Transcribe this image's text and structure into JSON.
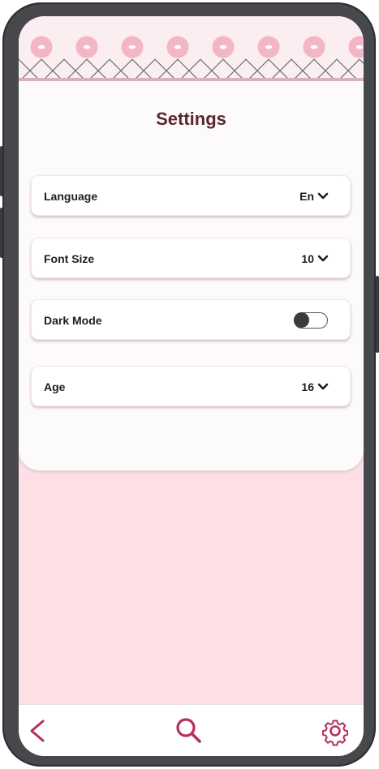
{
  "header": {
    "title": "Settings"
  },
  "settings": {
    "language": {
      "label": "Language",
      "value": "En"
    },
    "font_size": {
      "label": "Font Size",
      "value": "10"
    },
    "dark_mode": {
      "label": "Dark Mode",
      "enabled": false
    },
    "age": {
      "label": "Age",
      "value": "16"
    }
  },
  "nav": {
    "icons": [
      "back-icon",
      "search-icon",
      "gear-icon"
    ],
    "accent_color": "#b5305e"
  },
  "colors": {
    "background": "#fde0e6",
    "panel": "#fdfafa",
    "title": "#5a2633",
    "frame": "#47484c"
  }
}
